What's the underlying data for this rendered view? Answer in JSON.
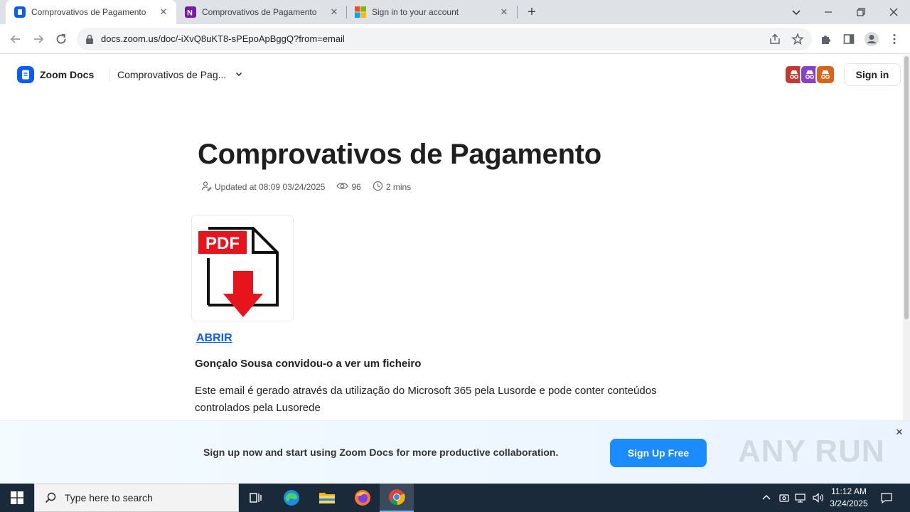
{
  "browser": {
    "tabs": [
      {
        "title": "Comprovativos de Pagamento",
        "icon": "zoom-docs-icon",
        "active": true
      },
      {
        "title": "Comprovativos de Pagamento",
        "icon": "onenote-icon",
        "active": false
      },
      {
        "title": "Sign in to your account",
        "icon": "microsoft-icon",
        "active": false
      }
    ],
    "url": "docs.zoom.us/doc/-iXvQ8uKT8-sPEpoApBggQ?from=email"
  },
  "header": {
    "brand": "Zoom Docs",
    "doc_switcher": "Comprovativos de Pag...",
    "sign_in": "Sign in"
  },
  "document": {
    "title": "Comprovativos de Pagamento",
    "updated": "Updated at 08:09 03/24/2025",
    "views": "96",
    "read_time": "2 mins",
    "pdf_label": "PDF",
    "open_link": "ABRIR",
    "invite_line": "Gonçalo Sousa convidou-o a ver um ficheiro",
    "body": "Este email é gerado através da utilização do Microsoft 365 pela Lusorde e pode conter conteúdos controlados pela Lusorede"
  },
  "banner": {
    "text": "Sign up now and start using Zoom Docs for more productive collaboration.",
    "cta": "Sign Up Free",
    "watermark": "ANY RUN"
  },
  "taskbar": {
    "search_placeholder": "Type here to search",
    "time": "11:12 AM",
    "date": "3/24/2025"
  },
  "colors": {
    "zoom_blue": "#0b5cff",
    "cta_blue": "#1a8cff",
    "pdf_red": "#e8141c"
  }
}
